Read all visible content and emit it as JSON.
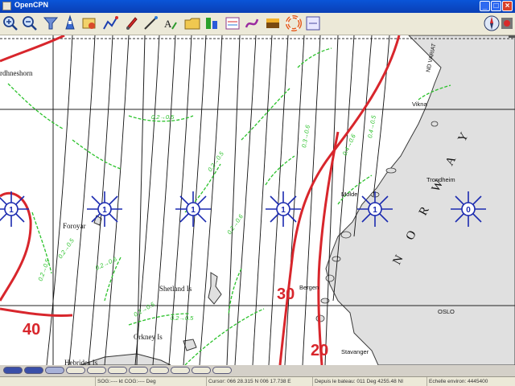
{
  "app": {
    "title": "OpenCPN"
  },
  "toolbar": {
    "tools": [
      "zoom-in",
      "zoom-out",
      "chart-quilt",
      "ship-follow",
      "settings",
      "route",
      "waypoint",
      "measure",
      "text-note",
      "chart-select",
      "tides",
      "currents",
      "grib-weather",
      "ais",
      "colour-scheme",
      "help"
    ],
    "compass_icon": "compass"
  },
  "chart": {
    "places": [
      "rdhneshorn",
      "Foroyar",
      "Shetland Is",
      "Orkney Is",
      "Hebrides Is",
      "Bergen",
      "Stavanger",
      "Molde",
      "Trondheim",
      "Vikna",
      "OSLO",
      "N O R W A Y"
    ],
    "isotherms": [
      "40",
      "30",
      "20"
    ],
    "ice_station_values": [
      "1",
      "1",
      "1",
      "1",
      "1",
      "0"
    ],
    "current_labels": [
      "0.2→0.5",
      "0.2→0.5",
      "0.2→0.6",
      "0.2→0.5",
      "0.2→0.6",
      "0.3→0.6",
      "0.4→0.6",
      "0.2→0.5",
      "0.2→0.5",
      "0.2→0.5",
      "0.4→0.5"
    ],
    "edge_text": "ND VARIAT"
  },
  "piano": {
    "keys": 11
  },
  "status": {
    "sog": "SOG:---- kt  COG:---- Deg",
    "cursor": "Cursor: 066 28.315 N 006 17.738 E",
    "depuis": "Depuis le bateau: 011 Deg  4255.48 NI",
    "scale": "Echelle environ: 4445400"
  },
  "colors": {
    "isotherm": "#d8262c",
    "current": "#2bc22b",
    "ice_symbol": "#1c2bb0",
    "land": "#e0e0e0",
    "grid": "#222222"
  }
}
